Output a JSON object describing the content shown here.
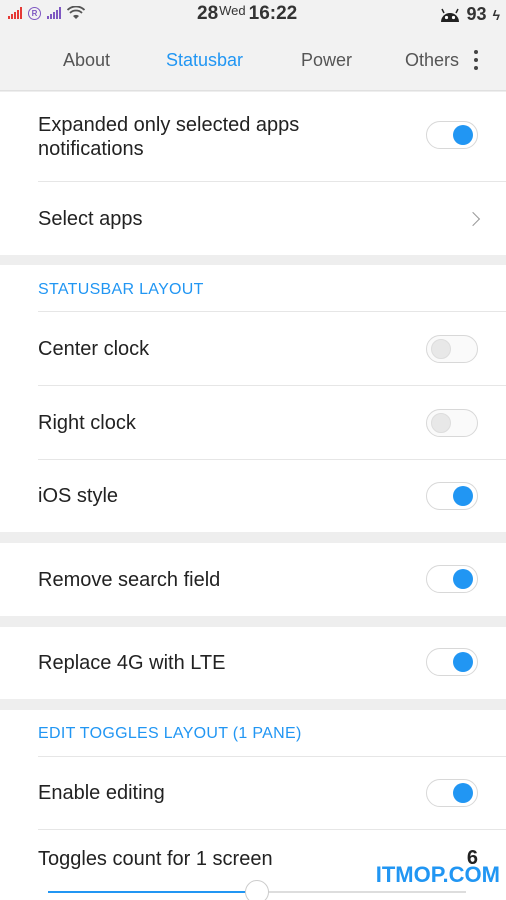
{
  "statusbar": {
    "date": "28",
    "weekday": "Wed",
    "time": "16:22",
    "battery": "93",
    "sim2_badge": "R"
  },
  "tabs": [
    {
      "label": "About",
      "active": false
    },
    {
      "label": "Statusbar",
      "active": true
    },
    {
      "label": "Power",
      "active": false
    },
    {
      "label": "Others",
      "active": false
    }
  ],
  "notifications": {
    "expanded_label": "Expanded only selected apps notifications",
    "expanded_on": true,
    "select_apps_label": "Select apps"
  },
  "layout": {
    "header": "STATUSBAR LAYOUT",
    "center_clock_label": "Center clock",
    "center_clock_on": false,
    "right_clock_label": "Right clock",
    "right_clock_on": false,
    "ios_style_label": "iOS style",
    "ios_style_on": true
  },
  "search": {
    "remove_search_label": "Remove search field",
    "remove_search_on": true
  },
  "network": {
    "replace_4g_label": "Replace 4G with LTE",
    "replace_4g_on": true
  },
  "toggles": {
    "header": "EDIT TOGGLES LAYOUT (1 PANE)",
    "enable_editing_label": "Enable editing",
    "enable_editing_on": true,
    "count_label": "Toggles count for 1 screen",
    "count_value": "6",
    "count_fraction": 0.5
  },
  "watermark": "ITMOP.COM",
  "colors": {
    "accent": "#2196f3",
    "background": "#eeeeee"
  }
}
